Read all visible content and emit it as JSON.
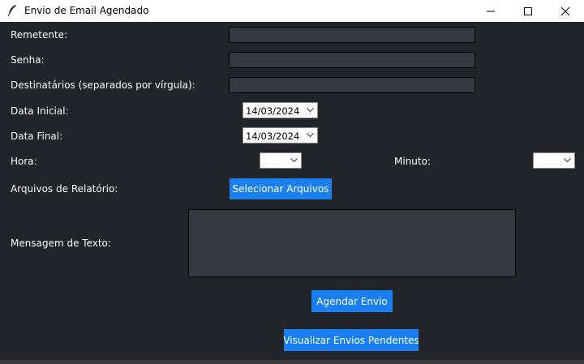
{
  "window": {
    "title": "Envio de Email Agendado",
    "icons": {
      "app": "feather-icon",
      "minimize": "minimize-icon",
      "maximize": "maximize-icon",
      "close": "close-icon"
    }
  },
  "form": {
    "remetente_label": "Remetente:",
    "remetente_value": "",
    "senha_label": "Senha:",
    "senha_value": "",
    "destinatarios_label": "Destinatários (separados por vírgula):",
    "destinatarios_value": "",
    "data_inicial_label": "Data Inicial:",
    "data_inicial_value": "14/03/2024",
    "data_final_label": "Data Final:",
    "data_final_value": "14/03/2024",
    "hora_label": "Hora:",
    "hora_value": "",
    "minuto_label": "Minuto:",
    "minuto_value": "",
    "arquivos_label": "Arquivos de Relatório:",
    "selecionar_button": "Selecionar Arquivos",
    "mensagem_label": "Mensagem de Texto:",
    "mensagem_value": ""
  },
  "actions": {
    "agendar_button": "Agendar Envio",
    "visualizar_button": "Visualizar Envios Pendentes"
  },
  "colors": {
    "background": "#212429",
    "field": "#353841",
    "button": "#1a7ff0"
  }
}
